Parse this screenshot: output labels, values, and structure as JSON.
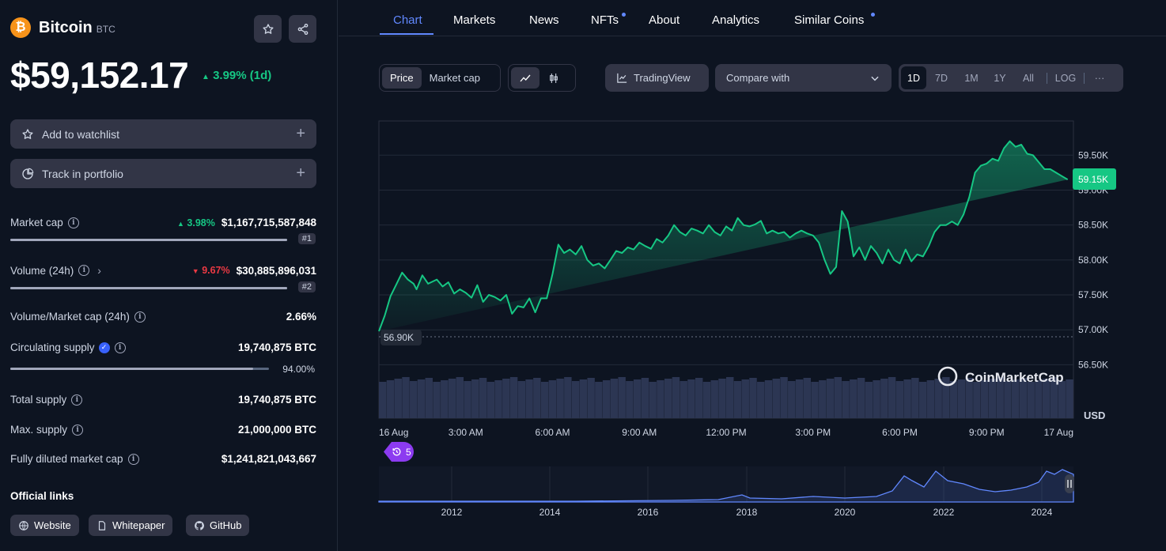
{
  "coin": {
    "name": "Bitcoin",
    "symbol": "BTC",
    "logo_glyph": "₿",
    "price": "$59,152.17",
    "change": "3.99% (1d)"
  },
  "actions": {
    "watchlist": "Add to watchlist",
    "portfolio": "Track in portfolio",
    "plus": "+"
  },
  "stats": {
    "market_cap": {
      "label": "Market cap",
      "change": "3.98%",
      "value": "$1,167,715,587,848",
      "rank": "#1"
    },
    "volume": {
      "label": "Volume (24h)",
      "change": "9.67%",
      "value": "$30,885,896,031",
      "rank": "#2"
    },
    "vol_mcap": {
      "label": "Volume/Market cap (24h)",
      "value": "2.66%"
    },
    "circ_supply": {
      "label": "Circulating supply",
      "value": "19,740,875 BTC",
      "percent": "94.00%"
    },
    "total_supply": {
      "label": "Total supply",
      "value": "19,740,875 BTC"
    },
    "max_supply": {
      "label": "Max. supply",
      "value": "21,000,000 BTC"
    },
    "fdmc": {
      "label": "Fully diluted market cap",
      "value": "$1,241,821,043,667"
    }
  },
  "links": {
    "title": "Official links",
    "website": "Website",
    "whitepaper": "Whitepaper",
    "github": "GitHub"
  },
  "tabs": [
    "Chart",
    "Markets",
    "News",
    "NFTs",
    "About",
    "Analytics",
    "Similar Coins"
  ],
  "controls": {
    "price": "Price",
    "market_cap": "Market cap",
    "tradingview": "TradingView",
    "compare": "Compare with",
    "ranges": [
      "1D",
      "7D",
      "1M",
      "1Y",
      "All",
      "LOG"
    ],
    "more": "···"
  },
  "events_badge": "5",
  "watermark": "CoinMarketCap",
  "colors": {
    "up": "#16c784",
    "down": "#ea3943",
    "accent": "#6188ff",
    "bitcoin": "#f7931a"
  },
  "chart_data": {
    "type": "area",
    "currency": "USD",
    "y_ticks": [
      "59.50K",
      "59.00K",
      "58.50K",
      "58.00K",
      "57.50K",
      "57.00K",
      "56.50K"
    ],
    "y_tick_values": [
      59500,
      59000,
      58500,
      58000,
      57500,
      57000,
      56500
    ],
    "ylim": [
      56380,
      59990
    ],
    "x_ticks": [
      "16 Aug",
      "3:00 AM",
      "6:00 AM",
      "9:00 AM",
      "12:00 PM",
      "3:00 PM",
      "6:00 PM",
      "9:00 PM",
      "17 Aug"
    ],
    "x_tick_hours": [
      0,
      3,
      6,
      9,
      12,
      15,
      18,
      21,
      24
    ],
    "open_label": "56.90K",
    "open_value": 56900,
    "last_label": "59.15K",
    "last_value": 59152,
    "x_hours": [
      0,
      0.2,
      0.4,
      0.6,
      0.8,
      1.0,
      1.2,
      1.3,
      1.5,
      1.7,
      2.0,
      2.2,
      2.4,
      2.6,
      2.8,
      3.0,
      3.2,
      3.4,
      3.6,
      3.8,
      4.0,
      4.2,
      4.4,
      4.6,
      4.8,
      5.0,
      5.2,
      5.4,
      5.5,
      5.6,
      5.8,
      6.0,
      6.2,
      6.4,
      6.6,
      6.8,
      7.0,
      7.2,
      7.4,
      7.6,
      7.8,
      8.0,
      8.2,
      8.4,
      8.6,
      8.8,
      9.0,
      9.2,
      9.4,
      9.6,
      9.8,
      10.0,
      10.2,
      10.4,
      10.6,
      10.8,
      11.0,
      11.2,
      11.4,
      11.6,
      11.8,
      12.0,
      12.2,
      12.4,
      12.6,
      12.8,
      13.0,
      13.2,
      13.4,
      13.6,
      13.8,
      14.0,
      14.2,
      14.4,
      14.6,
      14.8,
      15.0,
      15.2,
      15.4,
      15.6,
      15.8,
      16.0,
      16.2,
      16.4,
      16.6,
      16.8,
      17.0,
      17.2,
      17.4,
      17.6,
      17.8,
      18.0,
      18.2,
      18.4,
      18.6,
      18.8,
      19.0,
      19.2,
      19.4,
      19.6,
      19.8,
      20.0,
      20.2,
      20.4,
      20.6,
      20.8,
      21.0,
      21.2,
      21.4,
      21.6,
      21.8,
      22.0,
      22.2,
      22.4,
      22.6,
      22.8,
      23.0,
      23.2,
      23.4,
      23.6,
      23.8,
      24.0
    ],
    "values": [
      56980,
      57200,
      57480,
      57650,
      57820,
      57720,
      57660,
      57580,
      57780,
      57660,
      57720,
      57620,
      57680,
      57520,
      57580,
      57530,
      57460,
      57640,
      57400,
      57500,
      57470,
      57420,
      57500,
      57230,
      57340,
      57320,
      57450,
      57250,
      57350,
      57450,
      57450,
      57800,
      58220,
      58100,
      58150,
      58080,
      58200,
      58000,
      57920,
      57950,
      57880,
      58000,
      58130,
      58100,
      58180,
      58150,
      58250,
      58200,
      58160,
      58300,
      58250,
      58350,
      58500,
      58400,
      58350,
      58450,
      58420,
      58380,
      58500,
      58400,
      58350,
      58480,
      58420,
      58600,
      58500,
      58480,
      58510,
      58560,
      58380,
      58420,
      58380,
      58400,
      58320,
      58380,
      58420,
      58380,
      58350,
      58250,
      58000,
      57800,
      57900,
      58700,
      58550,
      58050,
      58180,
      58000,
      58200,
      58100,
      57950,
      58150,
      58000,
      57950,
      58150,
      57980,
      58080,
      58050,
      58200,
      58400,
      58500,
      58500,
      58550,
      58500,
      58650,
      58900,
      59250,
      59350,
      59380,
      59450,
      59420,
      59600,
      59700,
      59620,
      59650,
      59520,
      59500,
      59400,
      59300,
      59300,
      59250,
      59200,
      59152
    ],
    "navigator": {
      "x_ticks": [
        "2012",
        "2014",
        "2016",
        "2018",
        "2020",
        "2022",
        "2024"
      ]
    }
  }
}
